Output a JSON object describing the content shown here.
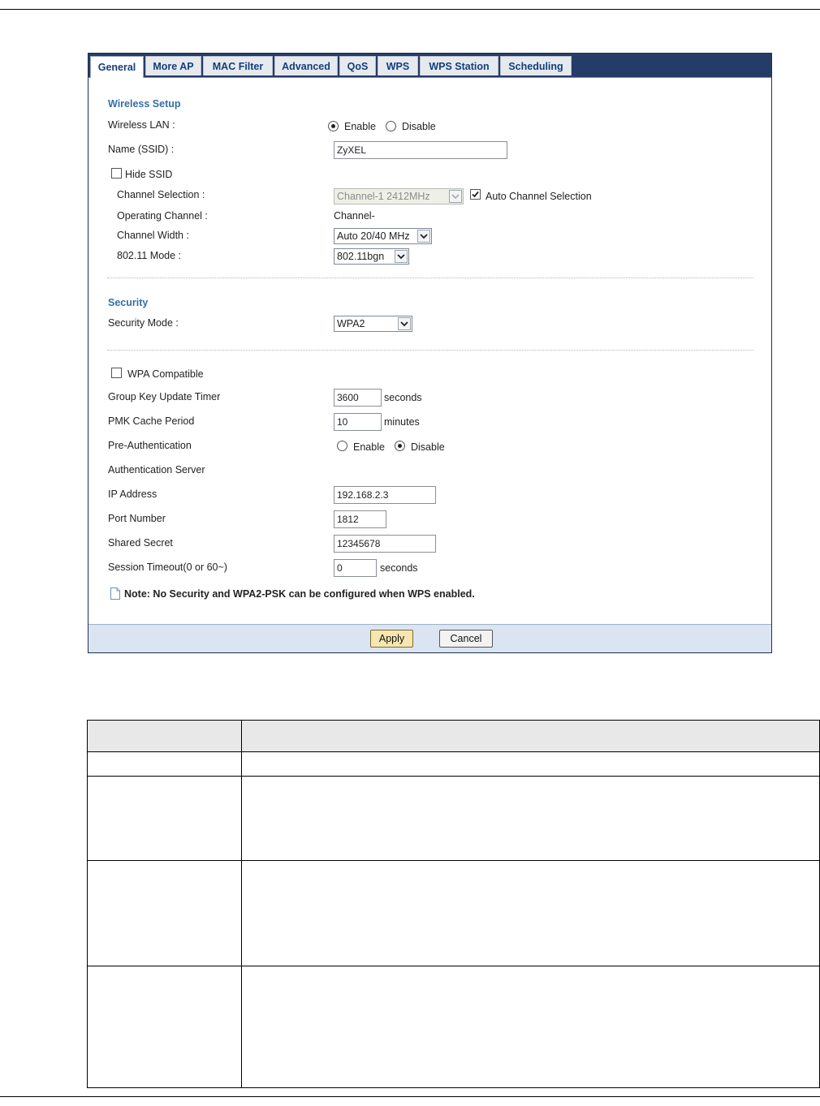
{
  "tabs": [
    {
      "label": "General",
      "active": true
    },
    {
      "label": "More AP",
      "active": false
    },
    {
      "label": "MAC Filter",
      "active": false
    },
    {
      "label": "Advanced",
      "active": false
    },
    {
      "label": "QoS",
      "active": false
    },
    {
      "label": "WPS",
      "active": false
    },
    {
      "label": "WPS Station",
      "active": false
    },
    {
      "label": "Scheduling",
      "active": false
    }
  ],
  "wireless_setup": {
    "title": "Wireless Setup",
    "wireless_lan_label": "Wireless LAN :",
    "enable_label": "Enable",
    "disable_label": "Disable",
    "wireless_lan_value": "Enable",
    "ssid_label": "Name (SSID) :",
    "ssid_value": "ZyXEL",
    "hide_ssid_label": "Hide SSID",
    "hide_ssid_checked": false,
    "channel_selection_label": "Channel Selection :",
    "channel_selection_value": "Channel-1 2412MHz",
    "auto_channel_label": "Auto Channel Selection",
    "auto_channel_checked": true,
    "operating_channel_label": "Operating Channel :",
    "operating_channel_value": "Channel-",
    "channel_width_label": "Channel Width :",
    "channel_width_value": "Auto 20/40 MHz",
    "mode_label": "802.11 Mode :",
    "mode_value": "802.11bgn"
  },
  "security": {
    "title": "Security",
    "mode_label": "Security Mode :",
    "mode_value": "WPA2",
    "wpa_compatible_label": "WPA Compatible",
    "wpa_compatible_checked": false,
    "group_key_label": "Group Key Update Timer",
    "group_key_value": "3600",
    "group_key_unit": "seconds",
    "pmk_label": "PMK Cache Period",
    "pmk_value": "10",
    "pmk_unit": "minutes",
    "preauth_label": "Pre-Authentication",
    "preauth_enable_label": "Enable",
    "preauth_disable_label": "Disable",
    "preauth_value": "Disable",
    "auth_server_label": "Authentication Server",
    "ip_label": "IP Address",
    "ip_value": "192.168.2.3",
    "port_label": "Port Number",
    "port_value": "1812",
    "secret_label": "Shared Secret",
    "secret_value": "12345678",
    "timeout_label": "Session Timeout(0 or 60~)",
    "timeout_value": "0",
    "timeout_unit": "seconds",
    "note": "Note: No Security and WPA2-PSK can be configured when WPS enabled."
  },
  "footer": {
    "apply_label": "Apply",
    "cancel_label": "Cancel"
  }
}
